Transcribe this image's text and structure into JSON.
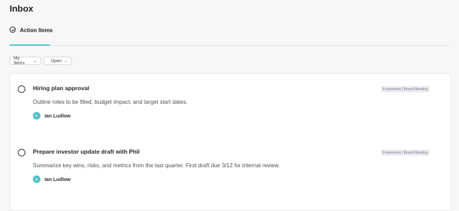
{
  "header": {
    "title": "Inbox"
  },
  "tabs": [
    {
      "label": "Action Items",
      "active": true
    }
  ],
  "filters": [
    {
      "label": "My Items"
    },
    {
      "label": "Open"
    }
  ],
  "items": [
    {
      "title": "Hiring plan approval",
      "description": "Outline roles to be filled, budget impact, and target start dates.",
      "tag": "Framework | Board Meeting",
      "assignee": {
        "initials": "IL",
        "name": "Ian Ludlow"
      }
    },
    {
      "title": "Prepare investor update draft with Phil",
      "description": "Summarize key wins, risks, and metrics from the last quarter. First draft due 3/12 for internal review.",
      "tag": "Framework | Board Meeting",
      "assignee": {
        "initials": "IL",
        "name": "Ian Ludlow"
      }
    }
  ],
  "colors": {
    "accent": "#4fc3c7",
    "background": "#f7f7f8"
  }
}
